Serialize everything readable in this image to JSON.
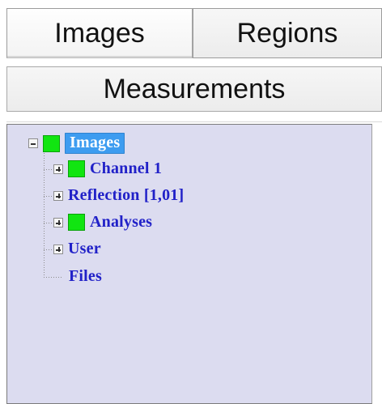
{
  "tabs": {
    "top": [
      {
        "label": "Images",
        "selected": true
      },
      {
        "label": "Regions",
        "selected": false
      }
    ],
    "measurements_label": "Measurements"
  },
  "tree": {
    "root": {
      "label": "Images",
      "expanded": true,
      "icon": "green-square-icon"
    },
    "children": [
      {
        "label": "Channel 1",
        "expanded": false,
        "icon": "green-square-icon"
      },
      {
        "label": "Reflection [1,01]",
        "expanded": false,
        "icon": ""
      },
      {
        "label": "Analyses",
        "expanded": false,
        "icon": "green-square-icon"
      },
      {
        "label": "User",
        "expanded": false,
        "icon": ""
      },
      {
        "label": "Files",
        "expanded": null,
        "icon": ""
      }
    ]
  },
  "colors": {
    "panel_background": "#dcdcf0",
    "tree_text": "#2121c8",
    "selection_background": "#3d9cf0",
    "green_indicator": "#11e511"
  }
}
